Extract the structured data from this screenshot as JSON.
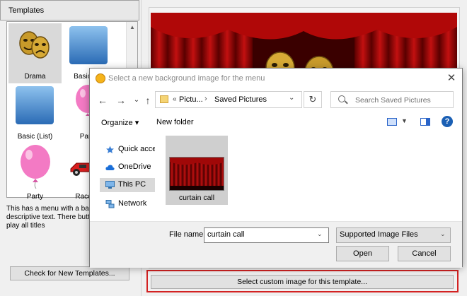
{
  "templates_panel": {
    "header": "Templates",
    "items": [
      {
        "label": "Drama",
        "icon": "theater-masks-icon"
      },
      {
        "label": "Basic Play",
        "icon": "blue-gradient-tile-icon"
      },
      {
        "label": "Basic (List)",
        "icon": "blue-gradient-tile-icon"
      },
      {
        "label": "Party (",
        "icon": "pink-balloon-icon"
      },
      {
        "label": "Party",
        "icon": "pink-balloon-icon"
      },
      {
        "label": "Racecars",
        "icon": "race-car-icon"
      }
    ],
    "description": "This has a menu with a back and descriptive text. There button that will play all titles",
    "check_button": "Check for New Templates..."
  },
  "preview": {
    "custom_image_button": "Select custom image for this template..."
  },
  "dialog": {
    "title": "Select a new background image for the menu",
    "close": "✕",
    "address": {
      "chevron": "«",
      "part1": "Pictu...",
      "separator": "›",
      "part2": "Saved Pictures"
    },
    "search_placeholder": "Search Saved Pictures",
    "toolbar": {
      "organize": "Organize ▾",
      "new_folder": "New folder",
      "help": "?"
    },
    "nav_items": [
      {
        "label": "Quick access",
        "icon": "star-icon"
      },
      {
        "label": "OneDrive",
        "icon": "cloud-icon"
      },
      {
        "label": "This PC",
        "icon": "computer-icon"
      },
      {
        "label": "Network",
        "icon": "network-icon"
      }
    ],
    "files": [
      {
        "label": "curtain call"
      }
    ],
    "filename_label": "File name:",
    "filename_value": "curtain call",
    "filetype_value": "Supported Image Files",
    "open_button": "Open",
    "cancel_button": "Cancel"
  },
  "colors": {
    "accent": "#1a5fb4",
    "highlight_border": "#d32222",
    "curtain_red": "#8b0000"
  }
}
